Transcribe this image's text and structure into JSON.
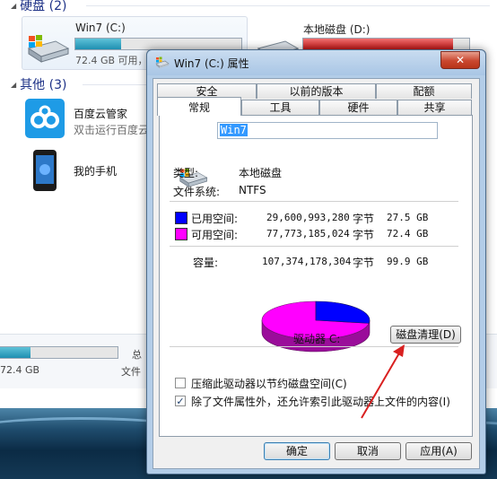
{
  "explorer": {
    "hdd_group": "硬盘 (2)",
    "other_group": "其他 (3)",
    "drive_c": {
      "name": "Win7 (C:)",
      "free_text": "72.4 GB 可用，",
      "used_fraction": 0.275
    },
    "drive_d": {
      "name": "本地磁盘 (D:)",
      "used_fraction": 0.9
    },
    "apps": [
      {
        "title": "百度云管家",
        "subtitle": "双击运行百度云"
      },
      {
        "title": "我的手机"
      }
    ],
    "status": {
      "size_text": "72.4 GB",
      "label_total": "总",
      "label_fs": "文件"
    }
  },
  "dialog": {
    "title": "Win7 (C:) 属性",
    "close_symbol": "✕",
    "tabs_top": [
      "安全",
      "以前的版本",
      "配额"
    ],
    "tabs_bottom": [
      "常规",
      "工具",
      "硬件",
      "共享"
    ],
    "active_tab": "常规",
    "drive_name_value": "Win7",
    "type_label": "类型:",
    "type_value": "本地磁盘",
    "fs_label": "文件系统:",
    "fs_value": "NTFS",
    "used": {
      "label": "已用空间:",
      "bytes": "29,600,993,280",
      "unit": "字节",
      "gb": "27.5 GB",
      "color": "#0000ff"
    },
    "free": {
      "label": "可用空间:",
      "bytes": "77,773,185,024",
      "unit": "字节",
      "gb": "72.4 GB",
      "color": "#ff00ff"
    },
    "capacity": {
      "label": "容量:",
      "bytes": "107,374,178,304",
      "unit": "字节",
      "gb": "99.9 GB"
    },
    "drive_label": "驱动器 C:",
    "cleanup_button": "磁盘清理(D)",
    "compress_option": {
      "label": "压缩此驱动器以节约磁盘空间(C)",
      "checked": false
    },
    "index_option": {
      "label": "除了文件属性外，还允许索引此驱动器上文件的内容(I)",
      "checked": true,
      "check_mark": "✓"
    },
    "buttons": {
      "ok": "确定",
      "cancel": "取消",
      "apply": "应用(A)"
    },
    "used_fraction": 0.2757
  },
  "colors": {
    "accent_arrow": "#d92020",
    "title_bar": "#b3cde8"
  }
}
